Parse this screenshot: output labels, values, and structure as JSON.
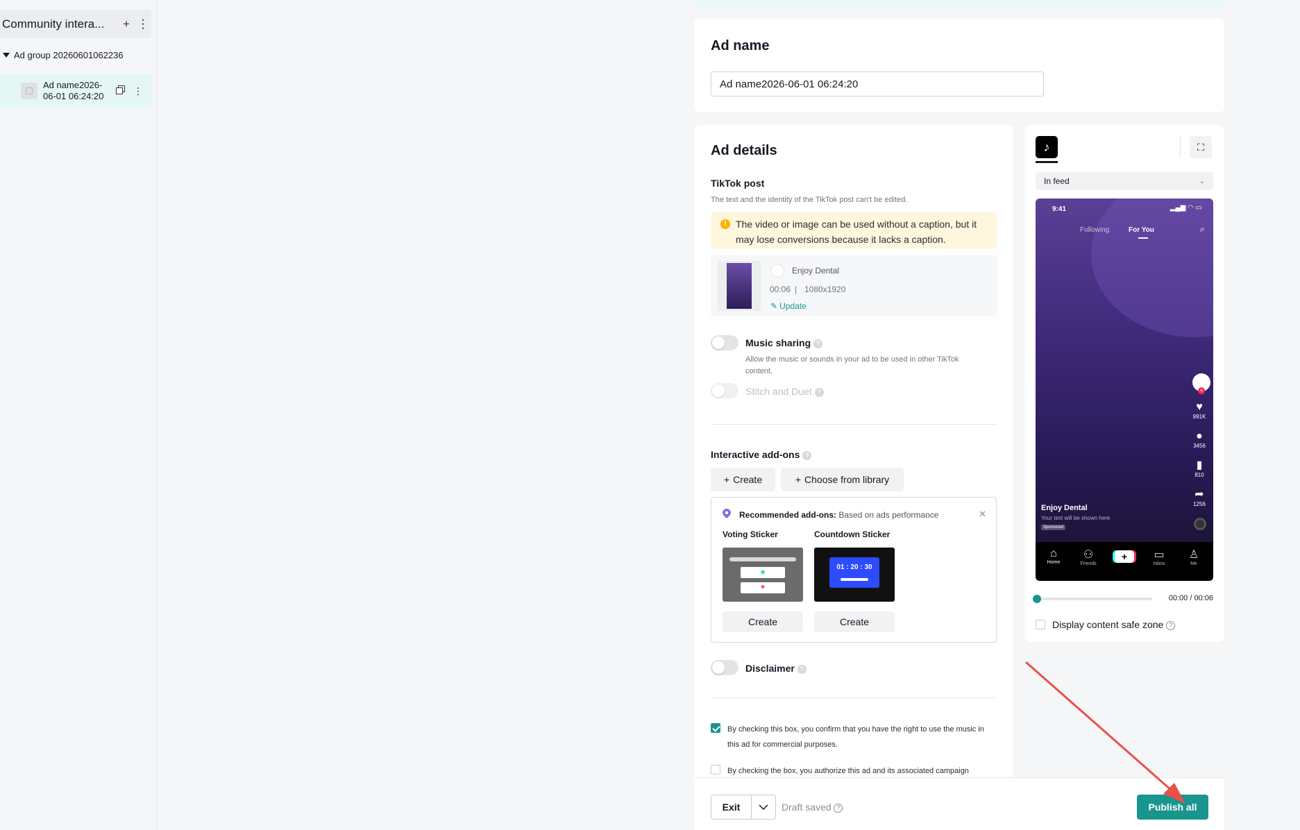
{
  "sidebar": {
    "campaign_title": "Community intera...",
    "add_icon": "+",
    "more_icon": "⋮",
    "ad_group_label": "Ad group 20260601062236",
    "ad_item_label": "Ad name2026-06-01 06:24:20"
  },
  "ad_name": {
    "title": "Ad name",
    "value": "Ad name2026-06-01 06:24:20"
  },
  "ad_details": {
    "title": "Ad details",
    "tiktok_post": {
      "title": "TikTok post",
      "subtitle": "The text and the identity of the TikTok post can't be edited.",
      "warning": "The video or image can be used without a caption, but it may lose conversions because it lacks a caption.",
      "account_name": "Enjoy Dental",
      "duration": "00:06",
      "separator": "|",
      "resolution": "1080x1920",
      "update_label": "Update"
    },
    "music_sharing": {
      "label": "Music sharing",
      "description": "Allow the music or sounds in your ad to be used in other TikTok content."
    },
    "stitch_duet": {
      "label": "Stitch and Duet"
    },
    "addons": {
      "title": "Interactive add-ons",
      "create_label": "Create",
      "library_label": "Choose from library",
      "recommended_label": "Recommended add-ons:",
      "recommended_note": "Based on ads performance",
      "voting_title": "Voting Sticker",
      "countdown_title": "Countdown Sticker",
      "countdown_time": "01 : 20 : 30",
      "sticker_create_label": "Create"
    },
    "disclaimer": {
      "label": "Disclaimer"
    },
    "consent_music": "By checking this box, you confirm that you have the right to use the music in this ad for commercial purposes.",
    "consent_authorize": "By checking the box, you authorize this ad and its associated campaign"
  },
  "preview": {
    "placement": "In feed",
    "status_time": "9:41",
    "tab_following": "Following",
    "tab_for_you": "For You",
    "likes": "991K",
    "comments": "3456",
    "saves": "810",
    "shares": "1256",
    "account": "Enjoy Dental",
    "caption_placeholder": "Your text will be shown here",
    "sponsored": "Sponsored",
    "nav_home": "Home",
    "nav_friends": "Friends",
    "nav_inbox": "Inbox",
    "nav_me": "Me",
    "timecode": "00:00 / 00:06",
    "progress": 0.0,
    "safe_zone_label": "Display content safe zone"
  },
  "footer": {
    "exit_label": "Exit",
    "draft_status": "Draft saved",
    "publish_label": "Publish all"
  },
  "colors": {
    "accent": "#17958e",
    "warning_bg": "#fef6dd",
    "selected_bg": "#e4f7f5",
    "annotation_arrow": "#e8504a"
  }
}
